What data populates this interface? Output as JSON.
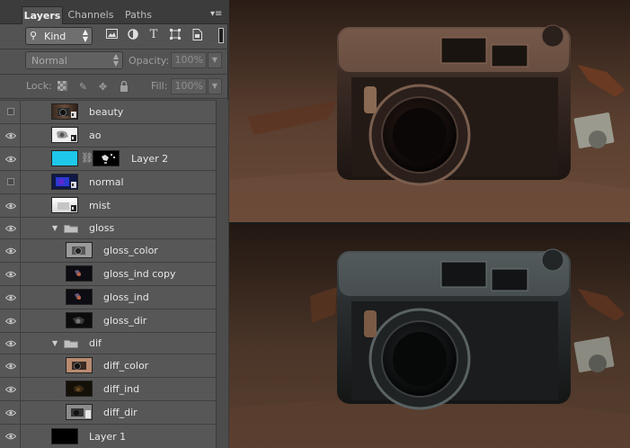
{
  "tabs": [
    "Layers",
    "Channels",
    "Paths"
  ],
  "filter": {
    "kind_label": "Kind",
    "icons": [
      "image-filter-icon",
      "adjustment-filter-icon",
      "type-filter-icon",
      "shape-filter-icon",
      "smart-object-filter-icon"
    ],
    "type_glyph": "T"
  },
  "blend": {
    "mode": "Normal",
    "opacity_label": "Opacity:",
    "opacity_value": "100%",
    "lock_label": "Lock:",
    "fill_label": "Fill:",
    "fill_value": "100%"
  },
  "layers": [
    {
      "name": "beauty",
      "visible": false,
      "kind": "layer",
      "thumb": "camera-warm"
    },
    {
      "name": "ao",
      "visible": true,
      "kind": "layer",
      "thumb": "white-ao"
    },
    {
      "name": "Layer 2",
      "visible": true,
      "kind": "masked",
      "thumb": "cyan-fill",
      "mask": "black-mask"
    },
    {
      "name": "normal",
      "visible": false,
      "kind": "layer",
      "thumb": "blue-normal"
    },
    {
      "name": "mist",
      "visible": true,
      "kind": "layer",
      "thumb": "white-mist"
    },
    {
      "name": "gloss",
      "visible": true,
      "kind": "group"
    },
    {
      "name": "gloss_color",
      "visible": true,
      "kind": "child",
      "thumb": "camera-gray"
    },
    {
      "name": "gloss_ind copy",
      "visible": true,
      "kind": "child",
      "thumb": "dark-spec"
    },
    {
      "name": "gloss_ind",
      "visible": true,
      "kind": "child",
      "thumb": "dark-spec"
    },
    {
      "name": "gloss_dir",
      "visible": true,
      "kind": "child",
      "thumb": "dark-spec-2"
    },
    {
      "name": "dif",
      "visible": true,
      "kind": "group"
    },
    {
      "name": "diff_color",
      "visible": true,
      "kind": "child",
      "thumb": "camera-tan"
    },
    {
      "name": "diff_ind",
      "visible": true,
      "kind": "child",
      "thumb": "dark-diff"
    },
    {
      "name": "diff_dir",
      "visible": true,
      "kind": "child",
      "thumb": "gray-diff"
    },
    {
      "name": "Layer 1",
      "visible": true,
      "kind": "layer",
      "thumb": "black-fill"
    }
  ],
  "colors": {
    "panel": "#535353",
    "cyan_fill": "#1ec8ea",
    "normal_blue": "#2a3ad0"
  }
}
